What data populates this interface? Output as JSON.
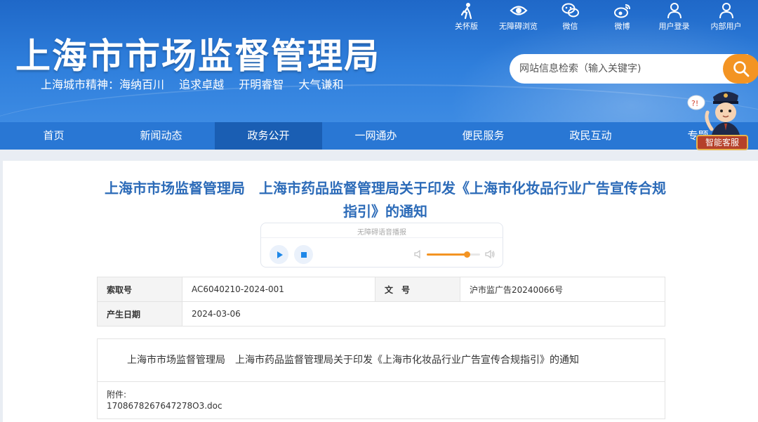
{
  "header": {
    "site_title": "上海市市场监督管理局",
    "spirit": [
      "上海城市精神：海纳百川",
      "追求卓越",
      "开明睿智",
      "大气谦和"
    ],
    "tools": [
      "关怀版",
      "无障碍浏览",
      "微信",
      "微博",
      "用户登录",
      "内部用户"
    ],
    "search_placeholder": "网站信息检索（输入关键字)",
    "assistant_label": "智能客服"
  },
  "nav": {
    "items": [
      "首页",
      "新闻动态",
      "政务公开",
      "一网通办",
      "便民服务",
      "政民互动",
      "专题"
    ],
    "active": "政务公开"
  },
  "article": {
    "title": "上海市市场监督管理局　上海市药品监督管理局关于印发《上海市化妆品行业广告宣传合规指引》的通知",
    "player_caption": "无障碍语音播报",
    "volume_level": 0.75,
    "meta": {
      "index_label": "索取号",
      "index_value": "AC6040210-2024-001",
      "doc_no_label": "文　号",
      "doc_no_value": "沪市监广告20240066号",
      "date_label": "产生日期",
      "date_value": "2024-03-06"
    },
    "body_text": "上海市市场监督管理局　上海市药品监督管理局关于印发《上海市化妆品行业广告宣传合规指引》的通知",
    "attachment_label": "附件:",
    "attachment_file": "1708678267647278O3.doc"
  },
  "colors": {
    "header_blue": "#2f7fdc",
    "nav_blue": "#2977d4",
    "nav_active": "#1a5eb3",
    "title_blue": "#2c6bb8",
    "accent_orange": "#f39423"
  }
}
